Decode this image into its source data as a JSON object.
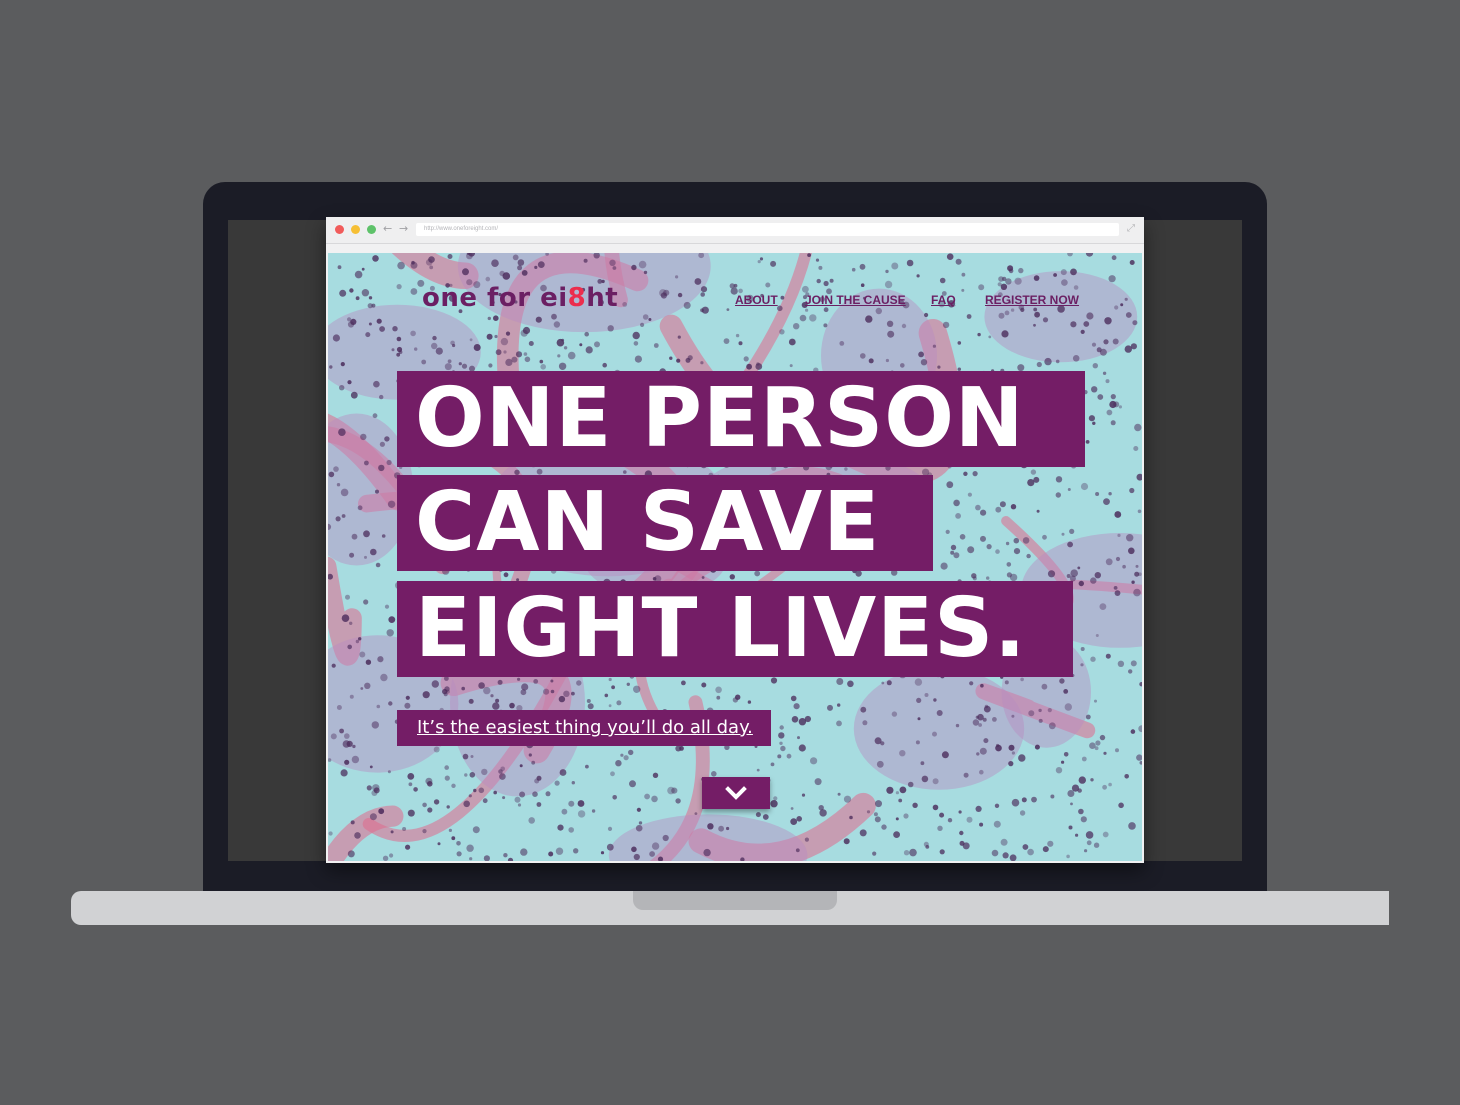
{
  "browser": {
    "url": "http://www.oneforeight.com/"
  },
  "site": {
    "logo": {
      "part1": "one for ei",
      "mark": "8",
      "part2": "ht"
    },
    "nav": [
      {
        "label": "ABOUT"
      },
      {
        "label": "JOIN THE CAUSE"
      },
      {
        "label": "FAQ"
      },
      {
        "label": "REGISTER NOW"
      }
    ],
    "headline": [
      "ONE PERSON",
      "CAN SAVE",
      "EIGHT LIVES."
    ],
    "tagline": "It’s the easiest thing you’ll do all day.",
    "colors": {
      "brand_purple": "#741d66",
      "logo_purple": "#6b1f63",
      "accent_red": "#ec2d4d",
      "background_cyan": "#a7dce0",
      "tissue_pink": "#e06a8c",
      "cell_purple": "#4a2a5a"
    },
    "scroll_icon": "chevron-down-icon"
  }
}
